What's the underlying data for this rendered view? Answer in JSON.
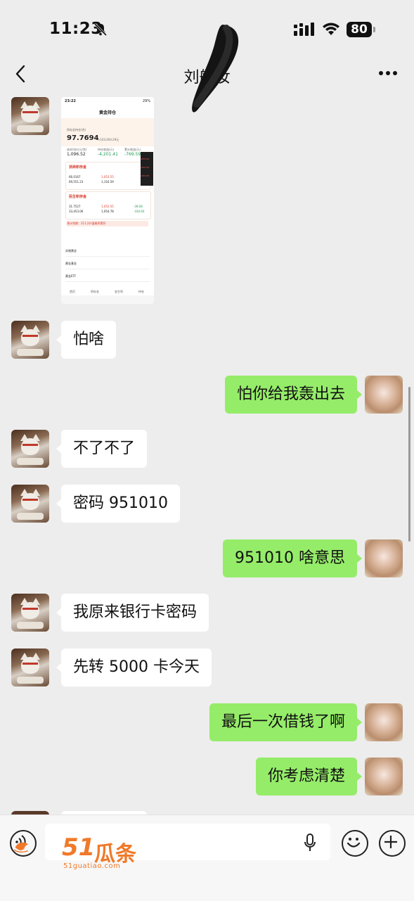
{
  "status_bar": {
    "time": "11:23",
    "battery": "80"
  },
  "chat": {
    "title": "刘航汝"
  },
  "screenshot_message": {
    "status_time": "23:22",
    "status_right": "29%",
    "title": "黄金持仓",
    "holdings_label": "积存金持仓(克)",
    "holdings_value": "97.7694",
    "holdings_sub": "≈103,004.29元",
    "cost_label": "成本均价(元/克)",
    "cost_value": "1,096.52",
    "pnl_label": "持仓收益(元)",
    "pnl_value": "-4,201.41",
    "acc_label": "累计收益(元)",
    "acc_value": "-769.59",
    "bank1_name": "浙商积存金",
    "bank1_qty": "66.0167",
    "bank1_amt": "69,551.23",
    "bank1_price": "1,053.55",
    "bank1_cost": "1,116.59",
    "bank2_name": "民生积存金",
    "bank2_qty": "31.7527",
    "bank2_amt": "33,453.06",
    "bank2_price": "1,053.55",
    "bank2_cost": "1,054.78",
    "bank2_pnl": "-39.06",
    "bank2_acc": "-334.93",
    "warning": "预计到期：211.2升值概率累积",
    "row1": "实物黄金",
    "row2": "黄金基金",
    "row3": "黄金ETF",
    "tab1": "首页",
    "tab2": "积存金",
    "tab3": "金生利",
    "tab4": "持仓",
    "dark_1": "1053.53",
    "dark_2": "1053.55",
    "dark_3": "1053.55"
  },
  "messages": [
    {
      "side": "in",
      "text": "怕啥"
    },
    {
      "side": "out",
      "text": "怕你给我轰出去"
    },
    {
      "side": "in",
      "text": "不了不了"
    },
    {
      "side": "in",
      "text": "密码 951010"
    },
    {
      "side": "out",
      "text": "951010 啥意思"
    },
    {
      "side": "in",
      "text": "我原来银行卡密码"
    },
    {
      "side": "in",
      "text": "先转 5000 卡今天"
    },
    {
      "side": "out",
      "text": "最后一次借钱了啊"
    },
    {
      "side": "out",
      "text": "你考虑清楚"
    }
  ],
  "input_bar": {
    "placeholder": ""
  },
  "watermark": {
    "number": "51",
    "name": "瓜条",
    "url": "51guatiao.com"
  },
  "colors": {
    "background": "#ededed",
    "outgoing_bubble": "#95ec69",
    "incoming_bubble": "#ffffff",
    "watermark": "#f07a2a"
  }
}
